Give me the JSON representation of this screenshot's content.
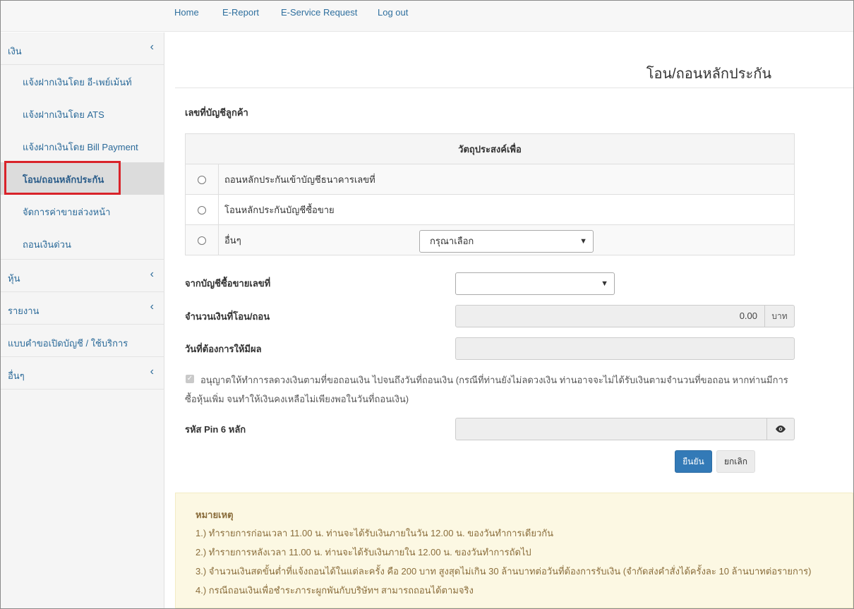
{
  "topnav": [
    "Home",
    "E-Report",
    "E-Service Request",
    "Log out"
  ],
  "sidebar": {
    "group_money": "เงิน",
    "sub_items": [
      "แจ้งฝากเงินโดย อี-เพย์เม้นท์",
      "แจ้งฝากเงินโดย ATS",
      "แจ้งฝากเงินโดย Bill Payment",
      "โอน/ถอนหลักประกัน",
      "จัดการค่าขายล่วงหน้า",
      "ถอนเงินด่วน"
    ],
    "groups_after": [
      "หุ้น",
      "รายงาน",
      "แบบคำขอเปิดบัญชี / ใช้บริการ",
      "อื่นๆ"
    ],
    "chevron": "‹"
  },
  "page": {
    "title": "โอน/ถอนหลักประกัน",
    "customer_account_label": "เลขที่บัญชีลูกค้า",
    "purpose_header": "วัตถุประสงค์เพื่อ",
    "purposes": [
      "ถอนหลักประกันเข้าบัญชีธนาคารเลขที่",
      "โอนหลักประกันบัญชีซื้อขาย",
      "อื่นๆ"
    ],
    "other_select_value": "กรุณาเลือก",
    "from_account_label": "จากบัญชีซื้อขายเลขที่",
    "amount_label": "จำนวนเงินที่โอน/ถอน",
    "amount_value": "0.00",
    "amount_unit": "บาท",
    "effective_date_label": "วันที่ต้องการให้มีผล",
    "consent_text": "อนุญาตให้ทำการลดวงเงินตามที่ขอถอนเงิน ไปจนถึงวันที่ถอนเงิน (กรณีที่ท่านยังไม่ลดวงเงิน ท่านอาจจะไม่ได้รับเงินตามจำนวนที่ขอถอน หากท่านมีการซื้อหุ้นเพิ่ม จนทำให้เงินคงเหลือไม่เพียงพอในวันที่ถอนเงิน)",
    "pin_label": "รหัส Pin 6 หลัก",
    "confirm_button": "ยืนยัน",
    "cancel_button": "ยกเลิก"
  },
  "note": {
    "title": "หมายเหตุ",
    "lines": [
      "1.) ทำรายการก่อนเวลา 11.00 น. ท่านจะได้รับเงินภายในวัน 12.00 น. ของวันทำการเดียวกัน",
      "2.) ทำรายการหลังเวลา 11.00 น. ท่านจะได้รับเงินภายใน 12.00 น. ของวันทำการถัดไป",
      "3.) จำนวนเงินสดขั้นต่ำที่แจ้งถอนได้ในแต่ละครั้ง คือ 200 บาท สูงสุดไม่เกิน 30 ล้านบาทต่อวันที่ต้องการรับเงิน (จำกัดส่งคำสั่งได้ครั้งละ 10 ล้านบาทต่อรายการ)",
      "4.) กรณีถอนเงินเพื่อชำระภาระผูกพันกับบริษัทฯ สามารถถอนได้ตามจริง"
    ]
  },
  "colors": {
    "link": "#2e6f9e",
    "primary_button": "#337ab7",
    "note_background": "#fcf8e3",
    "note_text": "#8a6d3b",
    "highlight_box": "#d9232a"
  },
  "icons": {
    "eye": "eye-icon",
    "check": "check-icon",
    "caret": "chevron-down-icon"
  }
}
